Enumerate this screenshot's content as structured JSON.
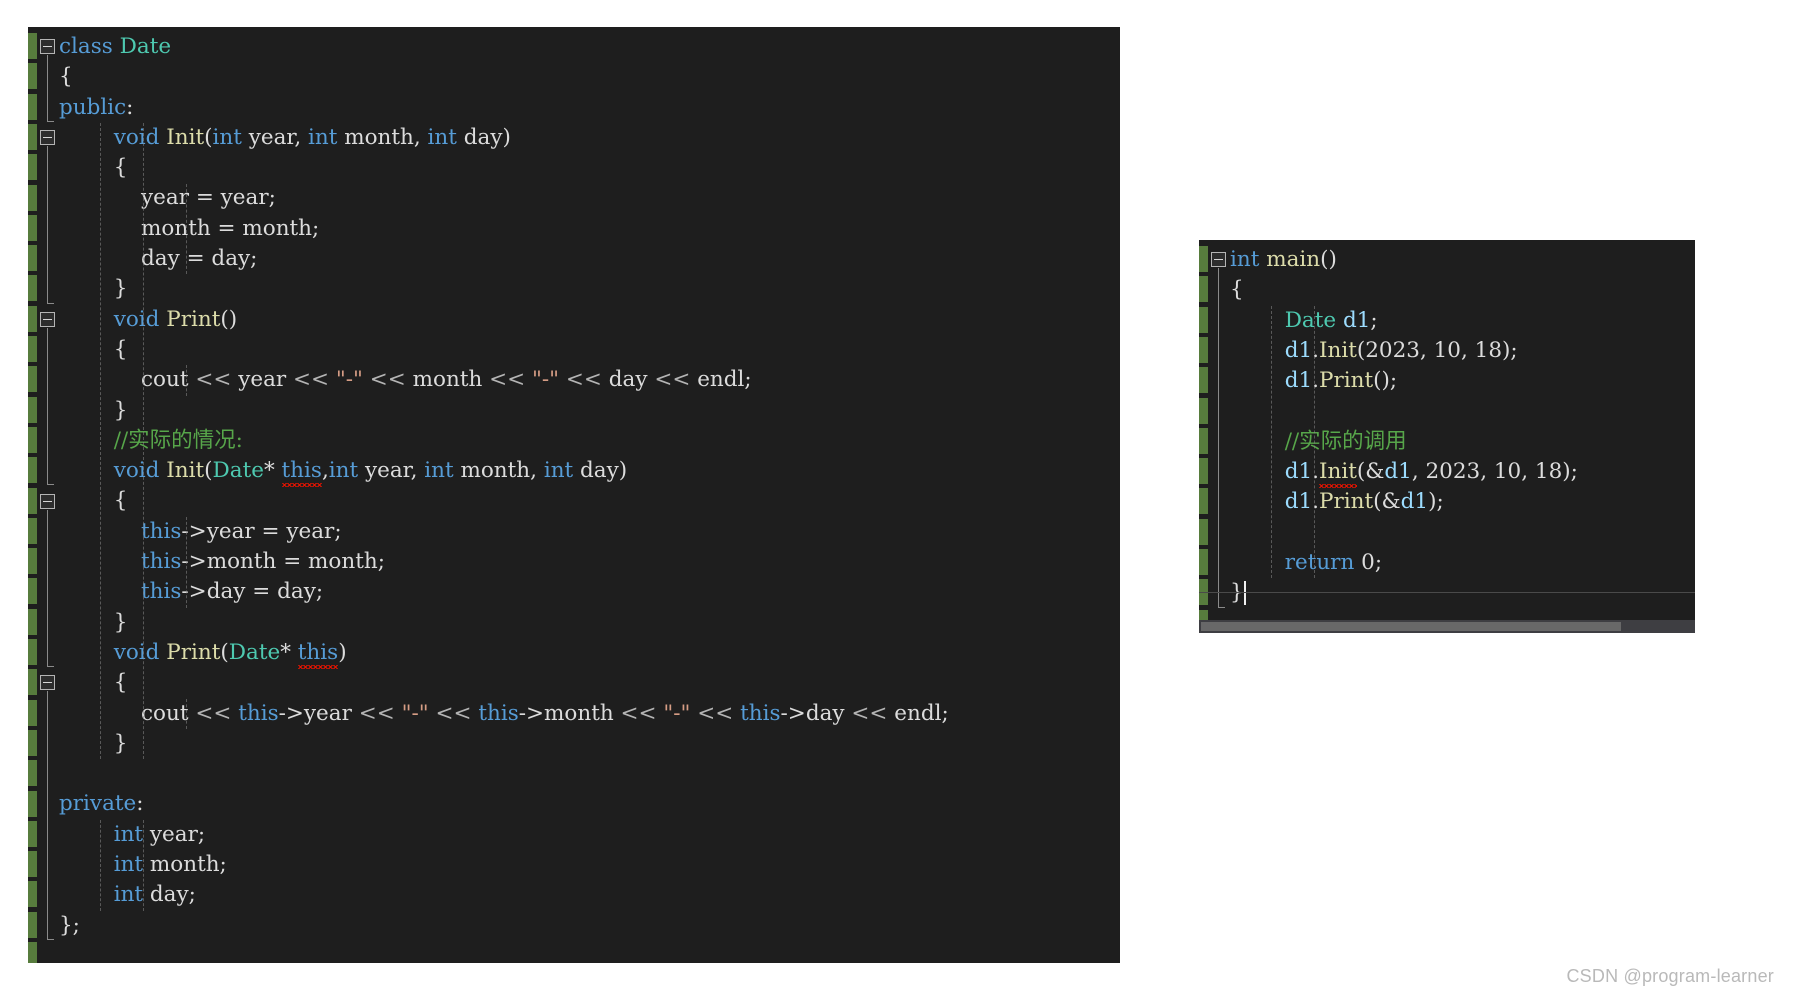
{
  "meta": {
    "editor_background": "#1e1e1e",
    "page_background": "#ffffff",
    "change_bar_color": "#577c3d",
    "keyword_color": "#569cd6",
    "type_color": "#4ec9b0",
    "function_color": "#dcdcaa",
    "string_color": "#d69d85",
    "comment_color": "#57a64a",
    "variable_color": "#9cdcfe",
    "plain_color": "#dcdcdc",
    "error_squiggle_color": "#e51400"
  },
  "left_panel": {
    "lines": [
      {
        "indent": 0,
        "tokens": [
          {
            "t": "class ",
            "c": "kw"
          },
          {
            "t": "Date",
            "c": "typ"
          }
        ]
      },
      {
        "indent": 0,
        "tokens": [
          {
            "t": "{",
            "c": "pl"
          }
        ]
      },
      {
        "indent": 0,
        "tokens": [
          {
            "t": "public",
            "c": "kw"
          },
          {
            "t": ":",
            "c": "pl"
          }
        ]
      },
      {
        "indent": 2,
        "tokens": [
          {
            "t": "void ",
            "c": "kw"
          },
          {
            "t": "Init",
            "c": "fn"
          },
          {
            "t": "(",
            "c": "pl"
          },
          {
            "t": "int",
            "c": "kw"
          },
          {
            "t": " year, ",
            "c": "pl"
          },
          {
            "t": "int",
            "c": "kw"
          },
          {
            "t": " month, ",
            "c": "pl"
          },
          {
            "t": "int",
            "c": "kw"
          },
          {
            "t": " day)",
            "c": "pl"
          }
        ]
      },
      {
        "indent": 2,
        "tokens": [
          {
            "t": "{",
            "c": "pl"
          }
        ]
      },
      {
        "indent": 3,
        "tokens": [
          {
            "t": "year = year;",
            "c": "pl"
          }
        ]
      },
      {
        "indent": 3,
        "tokens": [
          {
            "t": "month = month;",
            "c": "pl"
          }
        ]
      },
      {
        "indent": 3,
        "tokens": [
          {
            "t": "day = day;",
            "c": "pl"
          }
        ]
      },
      {
        "indent": 2,
        "tokens": [
          {
            "t": "}",
            "c": "pl"
          }
        ]
      },
      {
        "indent": 2,
        "tokens": [
          {
            "t": "void ",
            "c": "kw"
          },
          {
            "t": "Print",
            "c": "fn"
          },
          {
            "t": "()",
            "c": "pl"
          }
        ]
      },
      {
        "indent": 2,
        "tokens": [
          {
            "t": "{",
            "c": "pl"
          }
        ]
      },
      {
        "indent": 3,
        "tokens": [
          {
            "t": "cout ",
            "c": "pl"
          },
          {
            "t": "<< ",
            "c": "op"
          },
          {
            "t": "year ",
            "c": "pl"
          },
          {
            "t": "<< ",
            "c": "op"
          },
          {
            "t": "\"-\"",
            "c": "str"
          },
          {
            "t": " << ",
            "c": "op"
          },
          {
            "t": "month ",
            "c": "pl"
          },
          {
            "t": "<< ",
            "c": "op"
          },
          {
            "t": "\"-\"",
            "c": "str"
          },
          {
            "t": " << ",
            "c": "op"
          },
          {
            "t": "day ",
            "c": "pl"
          },
          {
            "t": "<< ",
            "c": "op"
          },
          {
            "t": "endl;",
            "c": "pl"
          }
        ]
      },
      {
        "indent": 2,
        "tokens": [
          {
            "t": "}",
            "c": "pl"
          }
        ]
      },
      {
        "indent": 2,
        "tokens": [
          {
            "t": "//实际的情况:",
            "c": "cmt"
          }
        ]
      },
      {
        "indent": 2,
        "tokens": [
          {
            "t": "void ",
            "c": "kw"
          },
          {
            "t": "Init",
            "c": "fn"
          },
          {
            "t": "(",
            "c": "pl"
          },
          {
            "t": "Date",
            "c": "typ"
          },
          {
            "t": "* ",
            "c": "pl"
          },
          {
            "t": "this",
            "c": "kw",
            "squiggle": true
          },
          {
            "t": ",",
            "c": "pl"
          },
          {
            "t": "int",
            "c": "kw"
          },
          {
            "t": " year, ",
            "c": "pl"
          },
          {
            "t": "int",
            "c": "kw"
          },
          {
            "t": " month, ",
            "c": "pl"
          },
          {
            "t": "int",
            "c": "kw"
          },
          {
            "t": " day)",
            "c": "pl"
          }
        ]
      },
      {
        "indent": 2,
        "tokens": [
          {
            "t": "{",
            "c": "pl"
          }
        ]
      },
      {
        "indent": 3,
        "tokens": [
          {
            "t": "this",
            "c": "kw"
          },
          {
            "t": "->year = year;",
            "c": "pl"
          }
        ]
      },
      {
        "indent": 3,
        "tokens": [
          {
            "t": "this",
            "c": "kw"
          },
          {
            "t": "->month = month;",
            "c": "pl"
          }
        ]
      },
      {
        "indent": 3,
        "tokens": [
          {
            "t": "this",
            "c": "kw"
          },
          {
            "t": "->day = day;",
            "c": "pl"
          }
        ]
      },
      {
        "indent": 2,
        "tokens": [
          {
            "t": "}",
            "c": "pl"
          }
        ]
      },
      {
        "indent": 2,
        "tokens": [
          {
            "t": "void ",
            "c": "kw"
          },
          {
            "t": "Print",
            "c": "fn"
          },
          {
            "t": "(",
            "c": "pl"
          },
          {
            "t": "Date",
            "c": "typ"
          },
          {
            "t": "* ",
            "c": "pl"
          },
          {
            "t": "this",
            "c": "kw",
            "squiggle": true
          },
          {
            "t": ")",
            "c": "pl"
          }
        ]
      },
      {
        "indent": 2,
        "tokens": [
          {
            "t": "{",
            "c": "pl"
          }
        ]
      },
      {
        "indent": 3,
        "tokens": [
          {
            "t": "cout ",
            "c": "pl"
          },
          {
            "t": "<< ",
            "c": "op"
          },
          {
            "t": "this",
            "c": "kw"
          },
          {
            "t": "->year ",
            "c": "pl"
          },
          {
            "t": "<< ",
            "c": "op"
          },
          {
            "t": "\"-\"",
            "c": "str"
          },
          {
            "t": " << ",
            "c": "op"
          },
          {
            "t": "this",
            "c": "kw"
          },
          {
            "t": "->month ",
            "c": "pl"
          },
          {
            "t": "<< ",
            "c": "op"
          },
          {
            "t": "\"-\"",
            "c": "str"
          },
          {
            "t": " << ",
            "c": "op"
          },
          {
            "t": "this",
            "c": "kw"
          },
          {
            "t": "->day ",
            "c": "pl"
          },
          {
            "t": "<< ",
            "c": "op"
          },
          {
            "t": "endl;",
            "c": "pl"
          }
        ]
      },
      {
        "indent": 2,
        "tokens": [
          {
            "t": "}",
            "c": "pl"
          }
        ]
      },
      {
        "indent": 0,
        "tokens": []
      },
      {
        "indent": 0,
        "tokens": [
          {
            "t": "private",
            "c": "kw"
          },
          {
            "t": ":",
            "c": "pl"
          }
        ]
      },
      {
        "indent": 2,
        "tokens": [
          {
            "t": "int",
            "c": "kw"
          },
          {
            "t": " year;",
            "c": "pl"
          }
        ]
      },
      {
        "indent": 2,
        "tokens": [
          {
            "t": "int",
            "c": "kw"
          },
          {
            "t": " month;",
            "c": "pl"
          }
        ]
      },
      {
        "indent": 2,
        "tokens": [
          {
            "t": "int",
            "c": "kw"
          },
          {
            "t": " day;",
            "c": "pl"
          }
        ]
      },
      {
        "indent": 0,
        "tokens": [
          {
            "t": "};",
            "c": "pl"
          }
        ]
      }
    ],
    "collapse_boxes": [
      {
        "line": 0
      },
      {
        "line": 3
      },
      {
        "line": 9
      },
      {
        "line": 15
      },
      {
        "line": 21
      }
    ]
  },
  "right_panel": {
    "lines": [
      {
        "indent": 0,
        "tokens": [
          {
            "t": "int ",
            "c": "kw"
          },
          {
            "t": "main",
            "c": "fn"
          },
          {
            "t": "()",
            "c": "pl"
          }
        ]
      },
      {
        "indent": 0,
        "tokens": [
          {
            "t": "{",
            "c": "pl"
          }
        ]
      },
      {
        "indent": 2,
        "tokens": [
          {
            "t": "Date",
            "c": "typ"
          },
          {
            "t": " ",
            "c": "pl"
          },
          {
            "t": "d1",
            "c": "var"
          },
          {
            "t": ";",
            "c": "pl"
          }
        ]
      },
      {
        "indent": 2,
        "tokens": [
          {
            "t": "d1",
            "c": "var"
          },
          {
            "t": ".",
            "c": "pl"
          },
          {
            "t": "Init",
            "c": "fn"
          },
          {
            "t": "(2023, 10, 18);",
            "c": "pl"
          }
        ]
      },
      {
        "indent": 2,
        "tokens": [
          {
            "t": "d1",
            "c": "var"
          },
          {
            "t": ".",
            "c": "pl"
          },
          {
            "t": "Print",
            "c": "fn"
          },
          {
            "t": "();",
            "c": "pl"
          }
        ]
      },
      {
        "indent": 2,
        "tokens": []
      },
      {
        "indent": 2,
        "tokens": [
          {
            "t": "//实际的调用",
            "c": "cmt"
          }
        ]
      },
      {
        "indent": 2,
        "tokens": [
          {
            "t": "d1",
            "c": "var"
          },
          {
            "t": ".",
            "c": "pl"
          },
          {
            "t": "Init",
            "c": "fn",
            "squiggle": true
          },
          {
            "t": "(&",
            "c": "pl"
          },
          {
            "t": "d1",
            "c": "var"
          },
          {
            "t": ", 2023, 10, 18);",
            "c": "pl"
          }
        ]
      },
      {
        "indent": 2,
        "tokens": [
          {
            "t": "d1",
            "c": "var"
          },
          {
            "t": ".",
            "c": "pl"
          },
          {
            "t": "Print",
            "c": "fn"
          },
          {
            "t": "(&",
            "c": "pl"
          },
          {
            "t": "d1",
            "c": "var"
          },
          {
            "t": ");",
            "c": "pl"
          }
        ]
      },
      {
        "indent": 2,
        "tokens": []
      },
      {
        "indent": 2,
        "tokens": [
          {
            "t": "return ",
            "c": "kw"
          },
          {
            "t": "0;",
            "c": "pl"
          }
        ]
      },
      {
        "indent": 0,
        "tokens": [
          {
            "t": "}",
            "c": "pl"
          }
        ]
      }
    ],
    "collapse_boxes": [
      {
        "line": 0
      }
    ],
    "caret_line": 11
  },
  "watermark": {
    "text": "CSDN @program-learner"
  }
}
